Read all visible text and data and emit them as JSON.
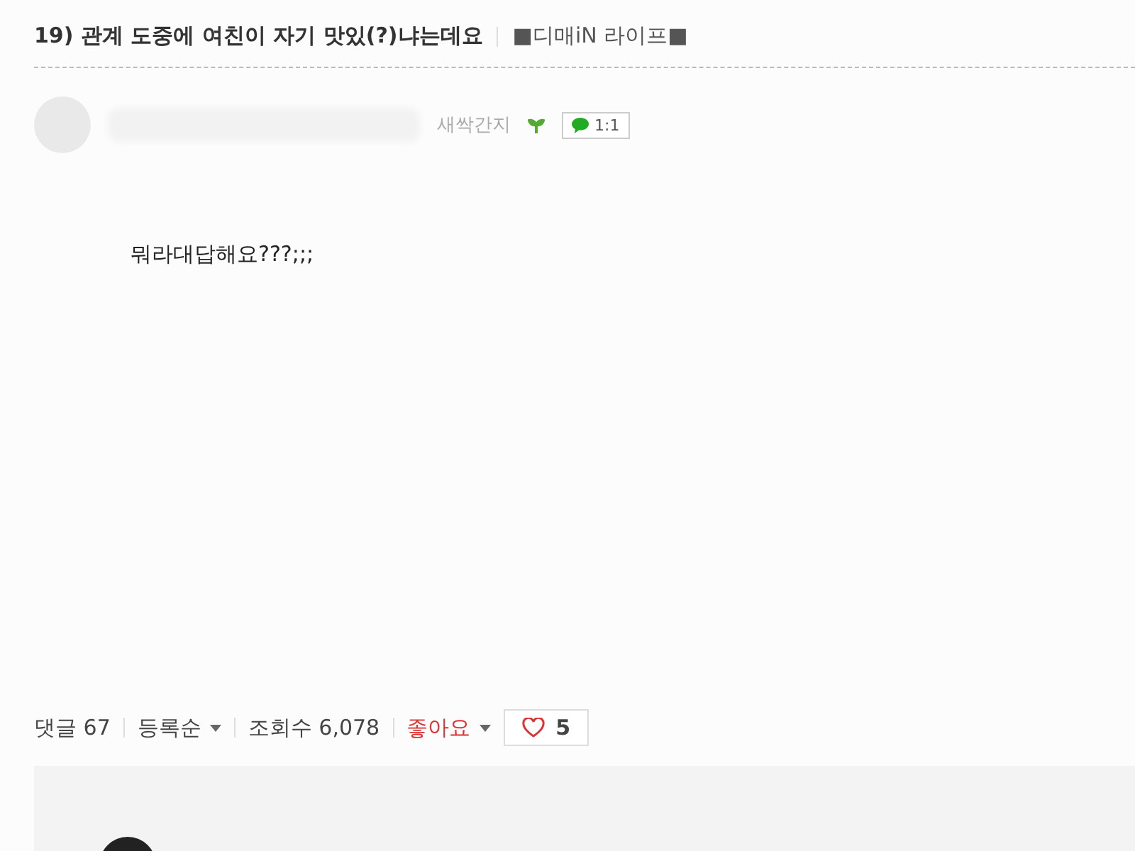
{
  "post": {
    "title": "19) 관계 도중에 여친이 자기 맛있(?)냐는데요",
    "board": "■디매iN 라이프■"
  },
  "author": {
    "level": "새싹간지",
    "chat_label": "1:1"
  },
  "body": "뭐라대답해요???;;;",
  "stats": {
    "comments_label": "댓글",
    "comments_count": "67",
    "sort": "등록순",
    "views_label": "조회수",
    "views": "6,078",
    "like_label": "좋아요",
    "like_count": "5"
  }
}
